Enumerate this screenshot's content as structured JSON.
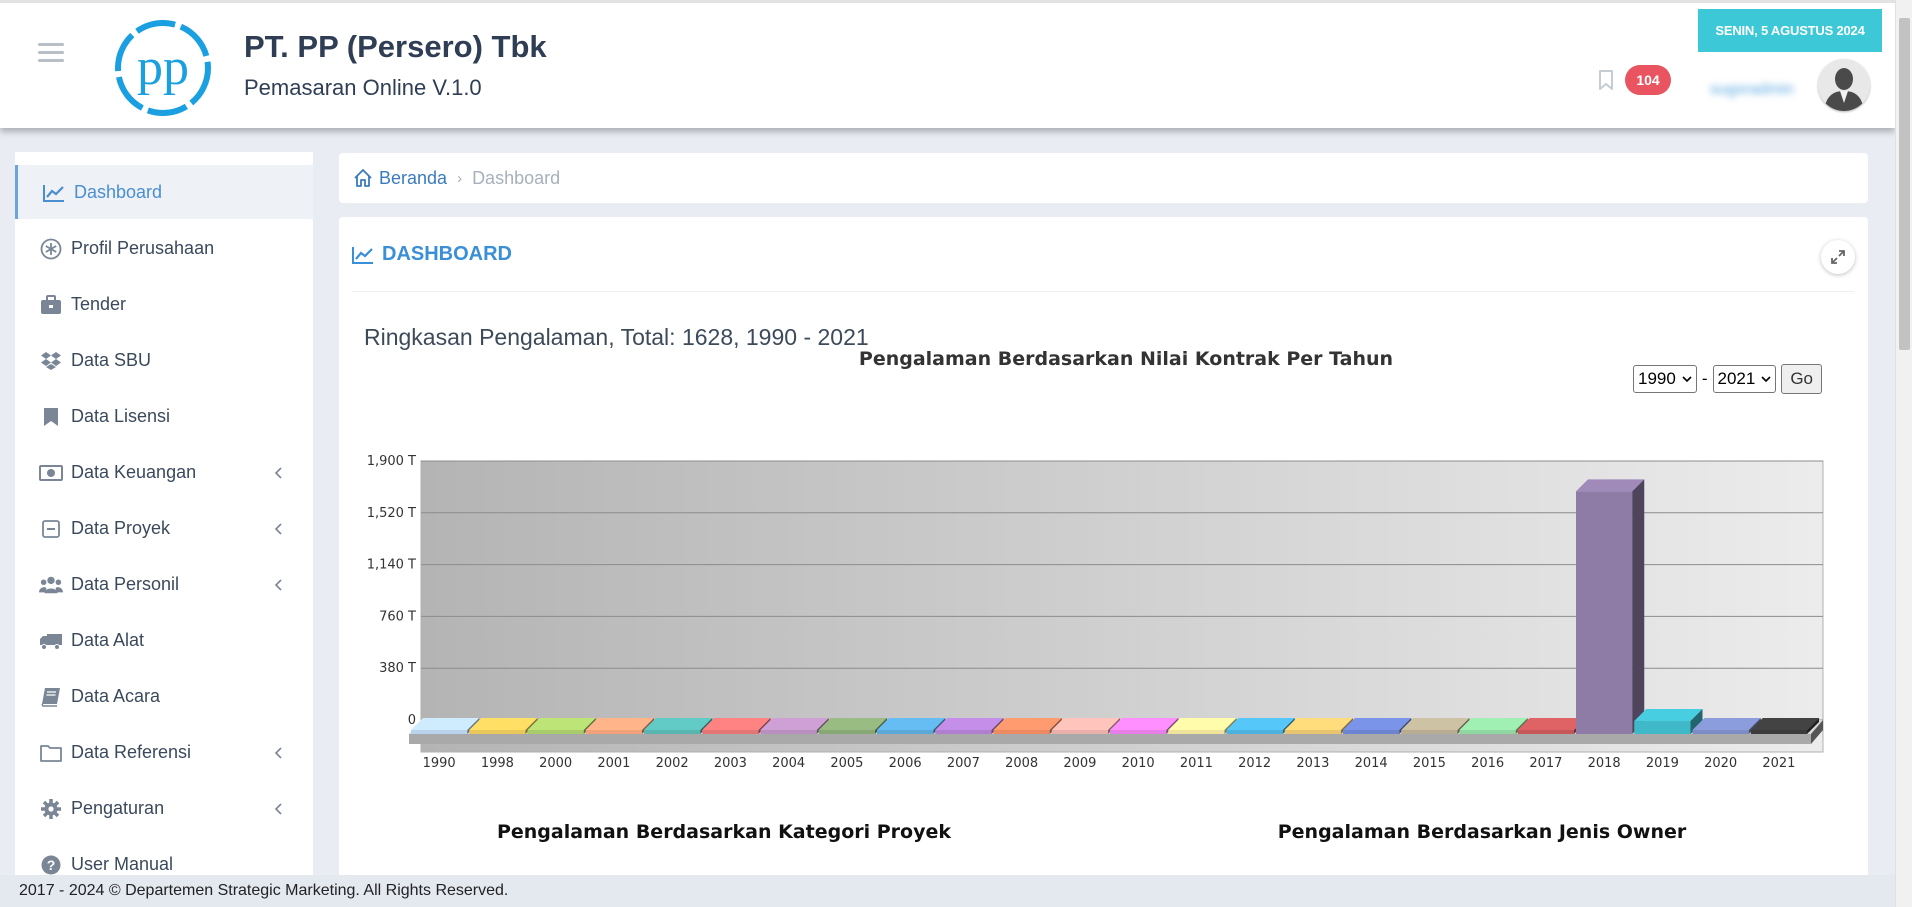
{
  "header": {
    "company": "PT. PP (Persero) Tbk",
    "subtitle": "Pemasaran Online V.1.0",
    "logo_text": "pp",
    "date": "SENIN, 5 AGUSTUS 2024",
    "notification_count": "104",
    "username": "sugoradmin"
  },
  "sidebar": {
    "items": [
      {
        "label": "Dashboard",
        "icon": "line-chart-icon",
        "active": true,
        "submenu": false
      },
      {
        "label": "Profil Perusahaan",
        "icon": "asterisk-circle-icon",
        "active": false,
        "submenu": false
      },
      {
        "label": "Tender",
        "icon": "briefcase-icon",
        "active": false,
        "submenu": false
      },
      {
        "label": "Data SBU",
        "icon": "dropbox-icon",
        "active": false,
        "submenu": false
      },
      {
        "label": "Data Lisensi",
        "icon": "bookmark-icon",
        "active": false,
        "submenu": false
      },
      {
        "label": "Data Keuangan",
        "icon": "money-icon",
        "active": false,
        "submenu": true
      },
      {
        "label": "Data Proyek",
        "icon": "minus-square-icon",
        "active": false,
        "submenu": true
      },
      {
        "label": "Data Personil",
        "icon": "users-icon",
        "active": false,
        "submenu": true
      },
      {
        "label": "Data Alat",
        "icon": "truck-icon",
        "active": false,
        "submenu": false
      },
      {
        "label": "Data Acara",
        "icon": "book-icon",
        "active": false,
        "submenu": false
      },
      {
        "label": "Data Referensi",
        "icon": "folder-icon",
        "active": false,
        "submenu": true
      },
      {
        "label": "Pengaturan",
        "icon": "gear-icon",
        "active": false,
        "submenu": true
      },
      {
        "label": "User Manual",
        "icon": "question-circle-icon",
        "active": false,
        "submenu": false
      }
    ]
  },
  "breadcrumb": {
    "home": "Beranda",
    "current": "Dashboard"
  },
  "panel": {
    "title": "DASHBOARD",
    "summary": "Ringkasan Pengalaman, Total: 1628, 1990 - 2021",
    "filter": {
      "from": "1990",
      "to": "2021",
      "separator": "-",
      "go_label": "Go"
    }
  },
  "chart_data": [
    {
      "type": "bar",
      "title": "Pengalaman Berdasarkan Nilai Kontrak Per Tahun",
      "categories": [
        "1990",
        "1998",
        "2000",
        "2001",
        "2002",
        "2003",
        "2004",
        "2005",
        "2006",
        "2007",
        "2008",
        "2009",
        "2010",
        "2011",
        "2012",
        "2013",
        "2014",
        "2015",
        "2016",
        "2017",
        "2018",
        "2019",
        "2020",
        "2021"
      ],
      "values": [
        5,
        4,
        3,
        6,
        9,
        10,
        9,
        7,
        8,
        10,
        10,
        8,
        9,
        10,
        11,
        12,
        10,
        11,
        12,
        11,
        1780,
        95,
        8,
        4
      ],
      "ylim": [
        0,
        1900
      ],
      "yticks": [
        "0",
        "380 T",
        "760 T",
        "1,140 T",
        "1,520 T",
        "1,900 T"
      ],
      "grid": true,
      "colors": [
        "#b9d3ec",
        "#e8c85a",
        "#a9cc6a",
        "#f2a27a",
        "#58b5b0",
        "#e47575",
        "#b98fbf",
        "#88a873",
        "#5aa9d9",
        "#b07fd0",
        "#ee8a62",
        "#e9b0a9",
        "#e77fe8",
        "#efe29a",
        "#4cb2dd",
        "#e8c46f",
        "#6d84d0",
        "#b8ad92",
        "#8fd6a0",
        "#c7585a",
        "#8e7ba6",
        "#3fb8c8",
        "#7c8cc4",
        "#3c3c3c"
      ]
    },
    {
      "type": "pie",
      "title": "Pengalaman Berdasarkan Kategori Proyek"
    },
    {
      "type": "pie",
      "title": "Pengalaman Berdasarkan Jenis Owner"
    }
  ],
  "footer": {
    "text": "2017 - 2024 © Departemen Strategic Marketing. All Rights Reserved."
  }
}
